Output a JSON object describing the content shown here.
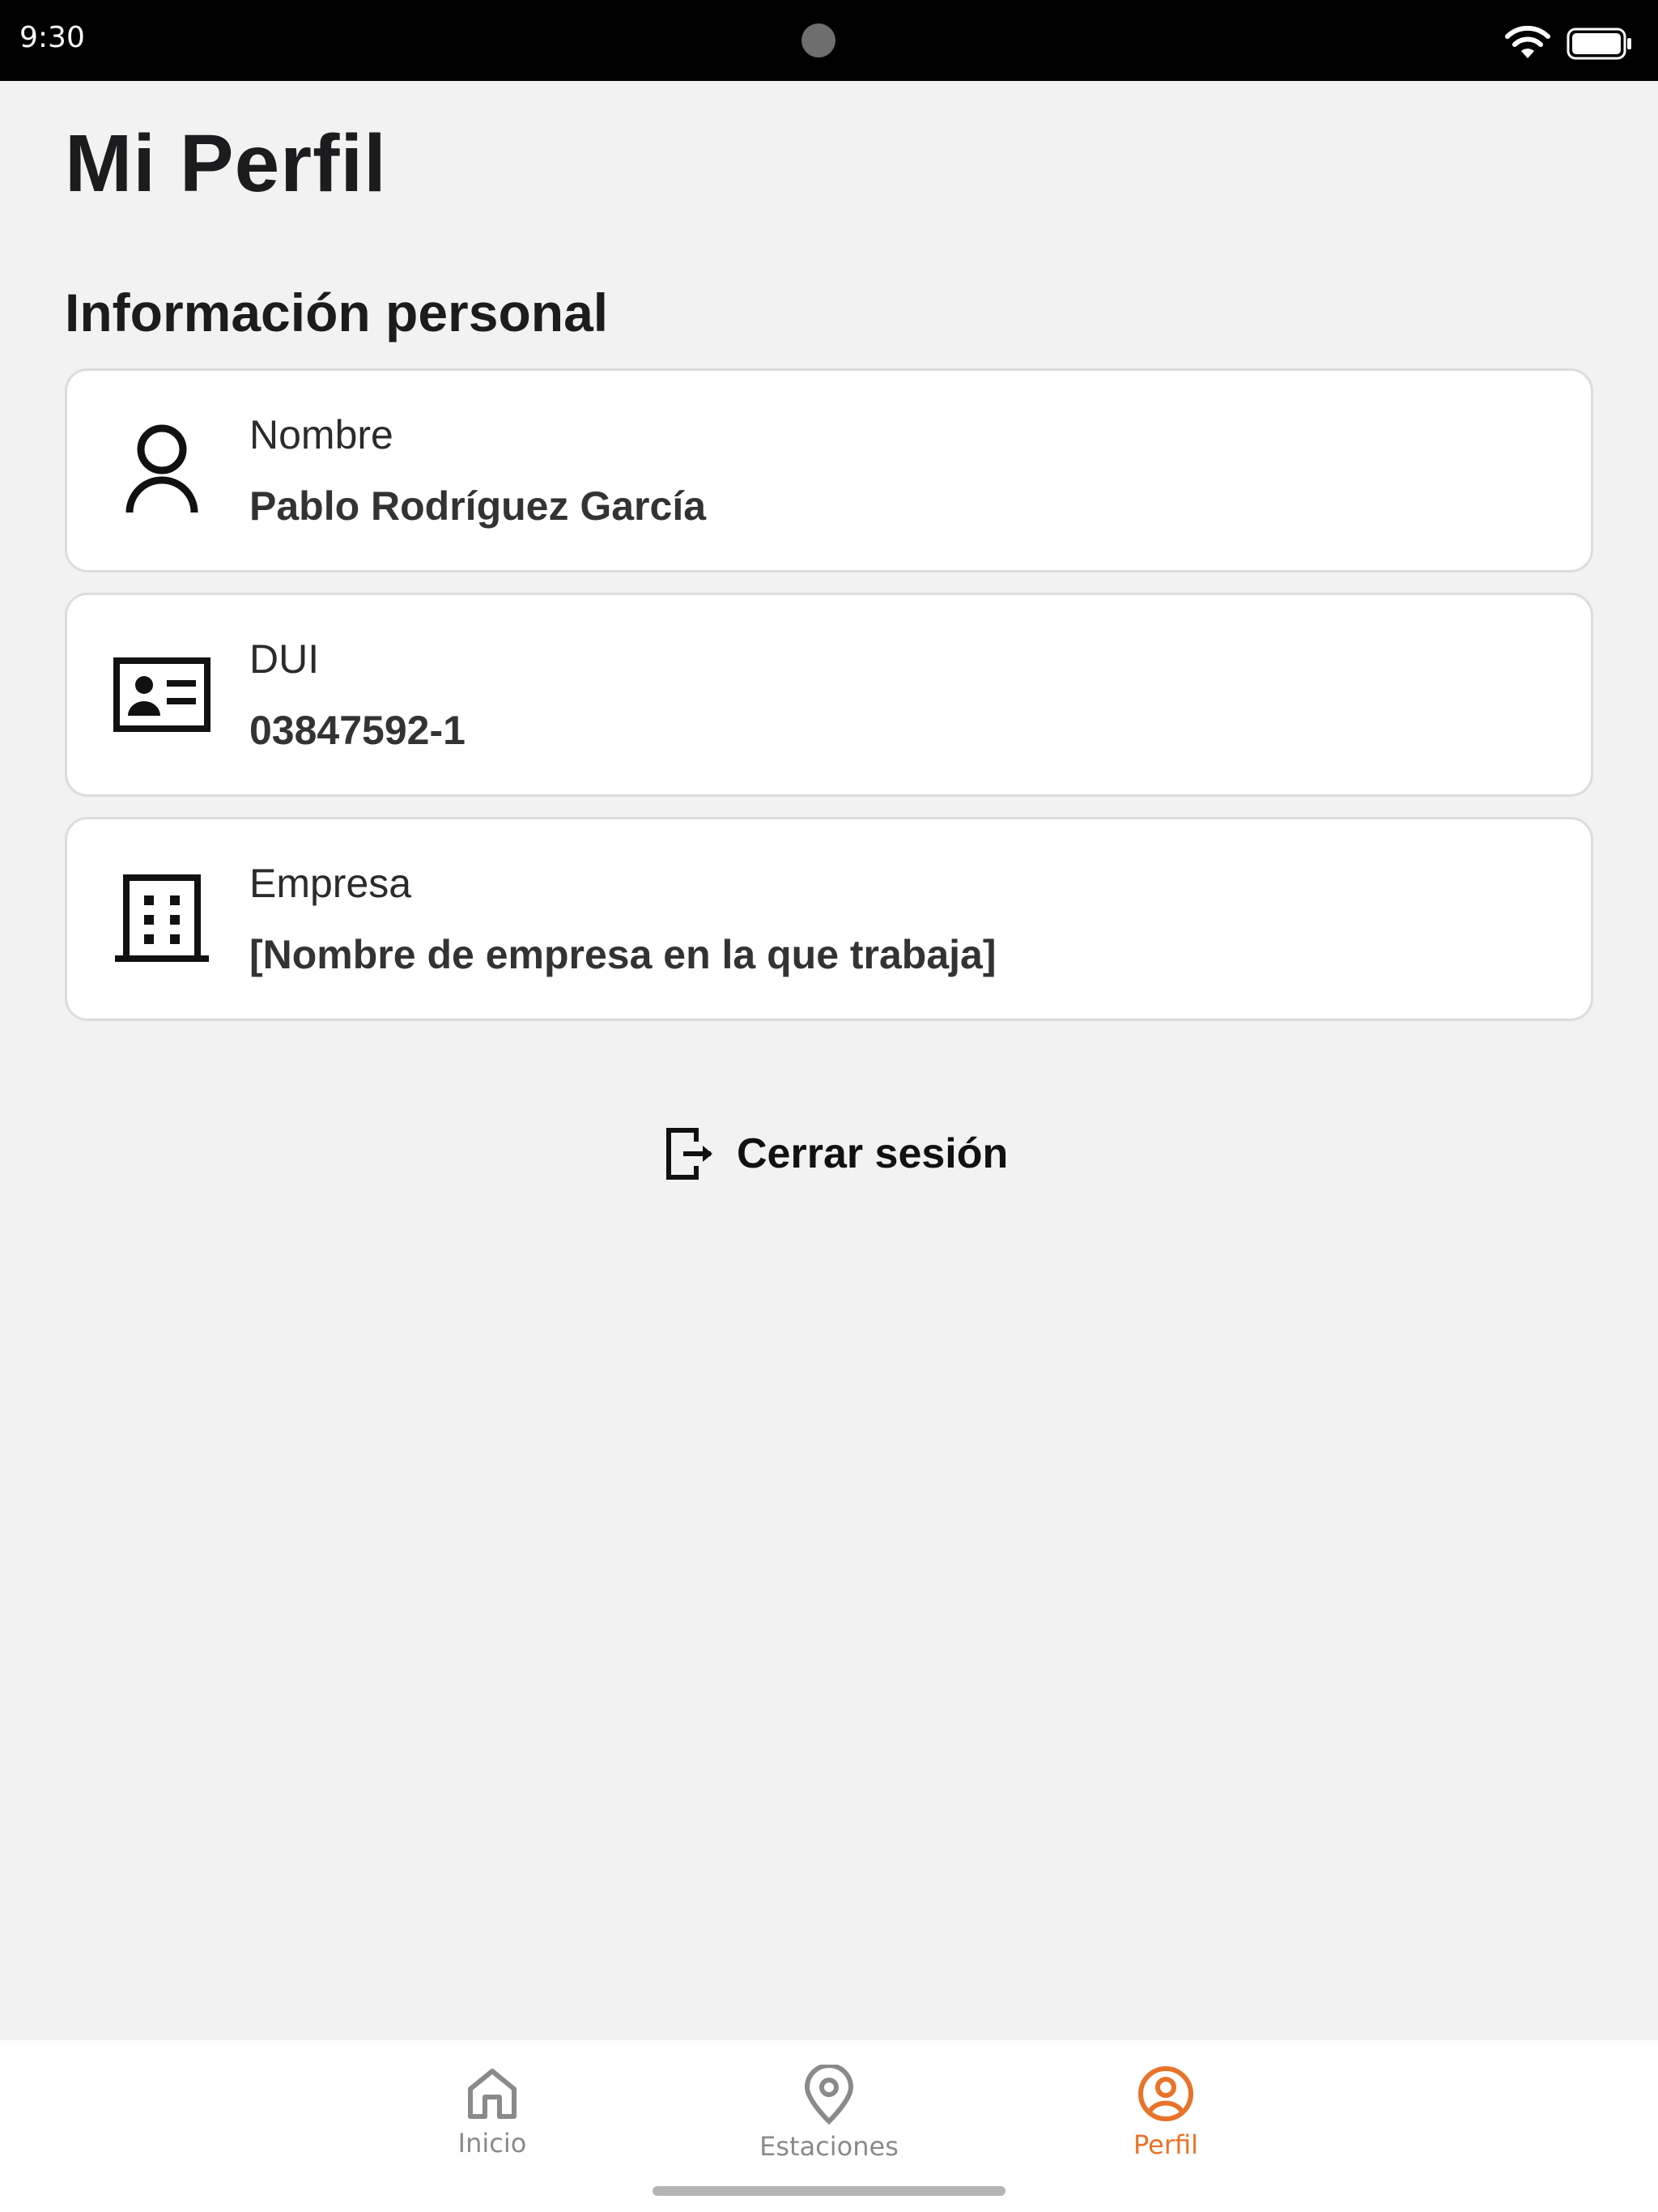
{
  "status_bar": {
    "time": "9:30"
  },
  "page": {
    "title": "Mi Perfil",
    "section_title": "Información personal"
  },
  "fields": [
    {
      "label": "Nombre",
      "value": "Pablo Rodríguez García",
      "icon": "user-icon"
    },
    {
      "label": "DUI",
      "value": "03847592-1",
      "icon": "id-card-icon"
    },
    {
      "label": "Empresa",
      "value": "[Nombre de empresa en la que trabaja]",
      "icon": "building-icon"
    }
  ],
  "logout": {
    "label": "Cerrar sesión",
    "icon": "logout-icon"
  },
  "tab_bar": {
    "tabs": [
      {
        "label": "Inicio",
        "icon": "home-icon",
        "active": false
      },
      {
        "label": "Estaciones",
        "icon": "location-pin-icon",
        "active": false
      },
      {
        "label": "Perfil",
        "icon": "profile-circle-icon",
        "active": true
      }
    ]
  },
  "colors": {
    "accent": "#e8732a",
    "inactive": "#8a8a8a",
    "background": "#f2f2f2"
  }
}
